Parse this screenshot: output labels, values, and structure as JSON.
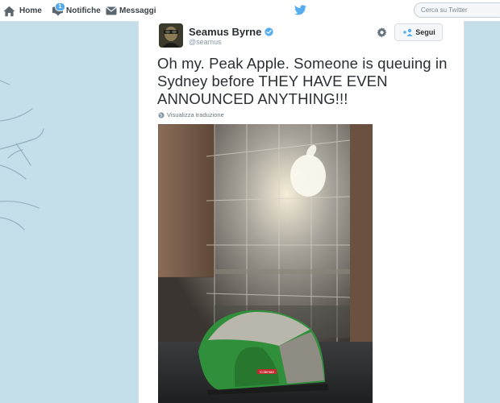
{
  "nav": {
    "home_label": "Home",
    "notifications_label": "Notifiche",
    "notifications_badge": "1",
    "messages_label": "Messaggi"
  },
  "search": {
    "placeholder": "Cerca su Twitter"
  },
  "tweet": {
    "display_name": "Seamus Byrne",
    "handle": "@seamus",
    "follow_label": "Segui",
    "text": "Oh my. Peak Apple. Someone is queuing in Sydney before THEY HAVE EVEN ANNOUNCED ANYTHING!!!",
    "translate_label": "Visualizza traduzione",
    "photo_tent_brand": "Coleman"
  },
  "colors": {
    "accent": "#55acee",
    "background": "#c4dfea",
    "tent_green": "#2f8f3a",
    "tent_brand_red": "#c8282d"
  }
}
